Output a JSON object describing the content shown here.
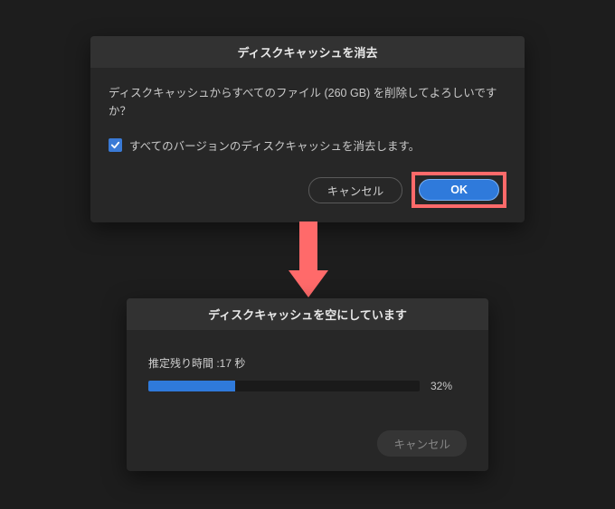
{
  "confirm_dialog": {
    "title": "ディスクキャッシュを消去",
    "message": "ディスクキャッシュからすべてのファイル (260 GB) を削除してよろしいですか？",
    "checkbox_label": "すべてのバージョンのディスクキャッシュを消去します。",
    "checkbox_checked": true,
    "cancel_label": "キャンセル",
    "ok_label": "OK"
  },
  "progress_dialog": {
    "title": "ディスクキャッシュを空にしています",
    "estimate_label": "推定残り時間 :17 秒",
    "percent_text": "32%",
    "percent_value": 32,
    "cancel_label": "キャンセル"
  },
  "colors": {
    "accent": "#2f7adb",
    "highlight": "#ff6a6a"
  }
}
